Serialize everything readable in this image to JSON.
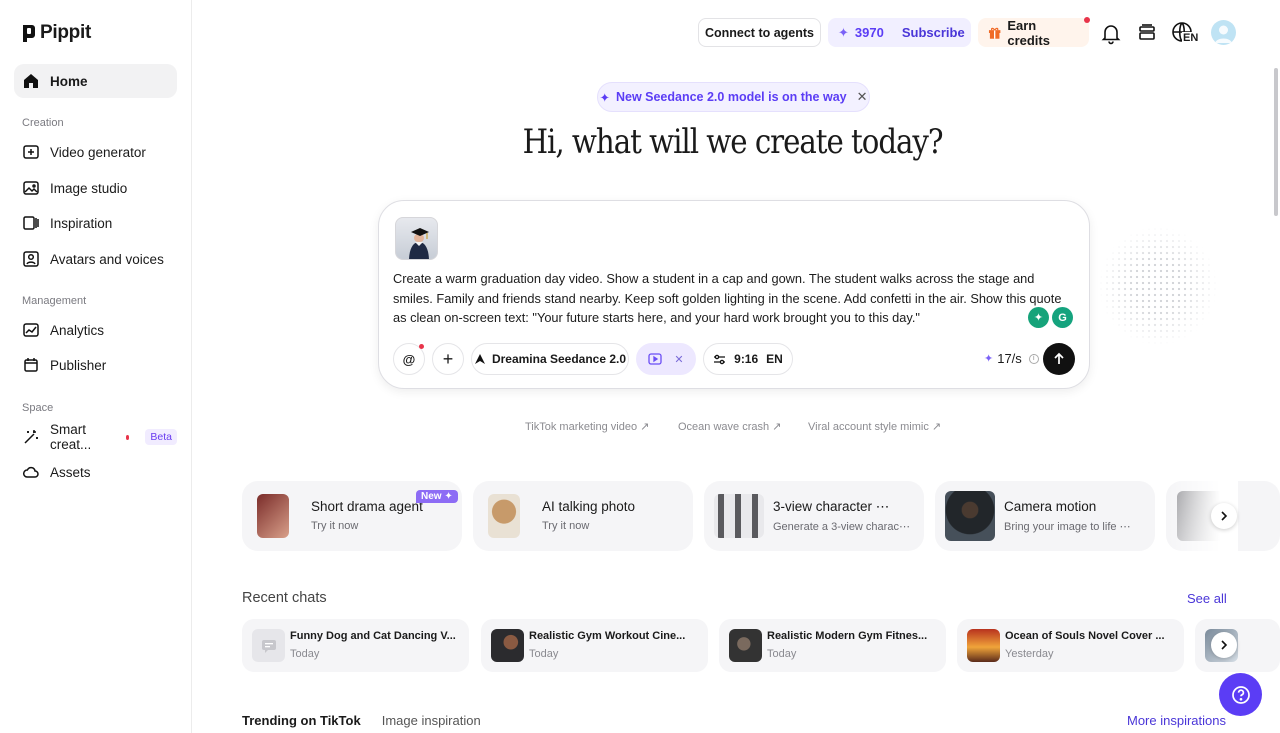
{
  "brand": {
    "name": "Pippit"
  },
  "sidebar": {
    "home": "Home",
    "sections": {
      "creation": "Creation",
      "management": "Management",
      "space": "Space"
    },
    "creation_items": [
      "Video generator",
      "Image studio",
      "Inspiration",
      "Avatars and voices"
    ],
    "management_items": [
      "Analytics",
      "Publisher"
    ],
    "space_items": {
      "smart_creation": "Smart creat...",
      "beta": "Beta",
      "assets": "Assets"
    }
  },
  "topbar": {
    "connect": "Connect to agents",
    "credits": "3970",
    "subscribe": "Subscribe",
    "earn": "Earn credits",
    "language": "EN"
  },
  "announcement": {
    "text": "New Seedance 2.0 model is on the way",
    "close": "✕"
  },
  "hero": {
    "title": "Hi, what will we create today?"
  },
  "prompt": {
    "text": "Create a warm graduation day video. Show a student in a cap and gown. The student walks across the stage and smiles. Family and friends stand nearby. Keep soft golden lighting in the scene. Add confetti in the air. Show this quote as clean on-screen text: \"Your future starts here, and your hard work brought you to this day.\"",
    "mention": "@",
    "add": "+",
    "model": "Dreamina Seedance 2.0",
    "ratio": "9:16",
    "lang": "EN",
    "rate": "17/s"
  },
  "suggestions": [
    "TikTok marketing video",
    "Ocean wave crash",
    "Viral account style mimic"
  ],
  "features": [
    {
      "title": "Short drama agent",
      "sub": "Try it now",
      "badge": "New"
    },
    {
      "title": "AI talking photo",
      "sub": "Try it now"
    },
    {
      "title": "3-view character ⋯",
      "sub": "Generate a 3-view charac⋯"
    },
    {
      "title": "Camera motion",
      "sub": "Bring your image to life ⋯"
    }
  ],
  "recent": {
    "title": "Recent chats",
    "see_all": "See all",
    "items": [
      {
        "title": "Funny Dog and Cat Dancing V...",
        "time": "Today"
      },
      {
        "title": "Realistic Gym Workout Cine...",
        "time": "Today"
      },
      {
        "title": "Realistic Modern Gym Fitnes...",
        "time": "Today"
      },
      {
        "title": "Ocean of Souls Novel Cover ...",
        "time": "Yesterday"
      }
    ]
  },
  "tabs": {
    "trending": "Trending on TikTok",
    "image": "Image inspiration",
    "more": "More inspirations"
  },
  "colors": {
    "accent": "#5b3df5",
    "link": "#4a36d8",
    "badge_red": "#e8344a"
  }
}
